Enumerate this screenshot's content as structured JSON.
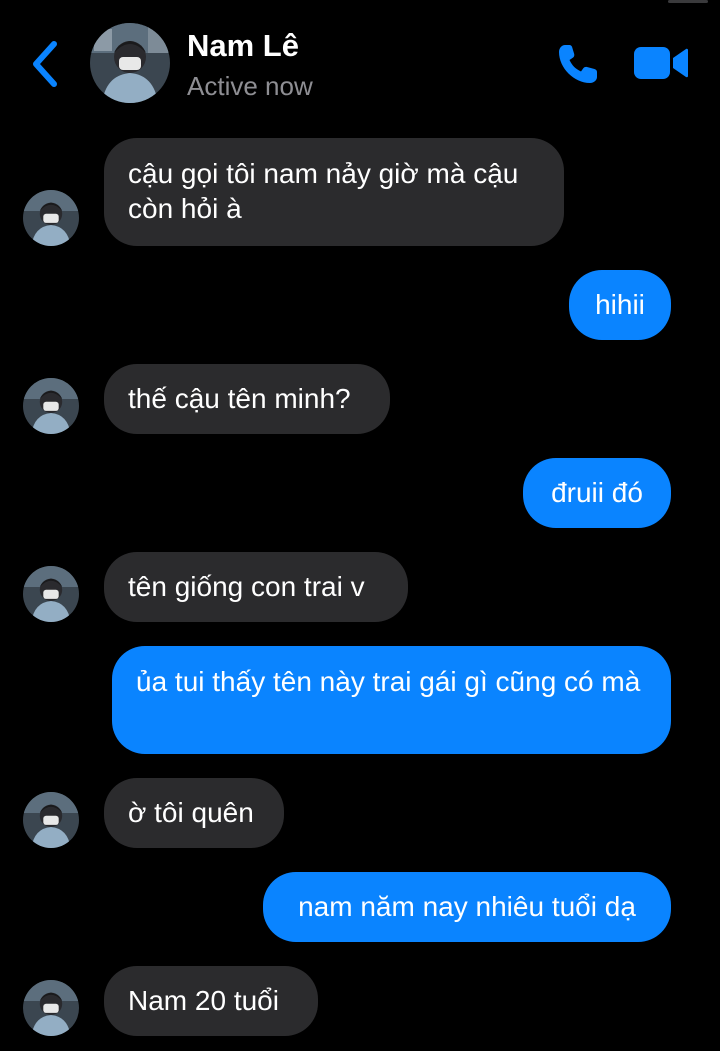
{
  "header": {
    "contact_name": "Nam Lê",
    "status": "Active now",
    "back_icon": "chevron-left-icon",
    "call_icon": "phone-icon",
    "video_icon": "video-camera-icon"
  },
  "colors": {
    "background": "#000000",
    "accent": "#0a84ff",
    "incoming_bubble": "#2b2b2d",
    "secondary_text": "#8e8e93"
  },
  "messages": [
    {
      "sender": "contact",
      "text": "cậu gọi tôi nam nảy giờ mà cậu còn hỏi à"
    },
    {
      "sender": "me",
      "text": "hihii"
    },
    {
      "sender": "contact",
      "text": "thế cậu tên minh?"
    },
    {
      "sender": "me",
      "text": "đruii đó"
    },
    {
      "sender": "contact",
      "text": "tên giống con trai v"
    },
    {
      "sender": "me",
      "text": "ủa tui thấy tên này trai gái gì cũng có mà"
    },
    {
      "sender": "contact",
      "text": "ờ tôi quên"
    },
    {
      "sender": "me",
      "text": "nam năm nay nhiêu tuổi dạ"
    },
    {
      "sender": "contact",
      "text": "Nam 20 tuổi"
    }
  ]
}
